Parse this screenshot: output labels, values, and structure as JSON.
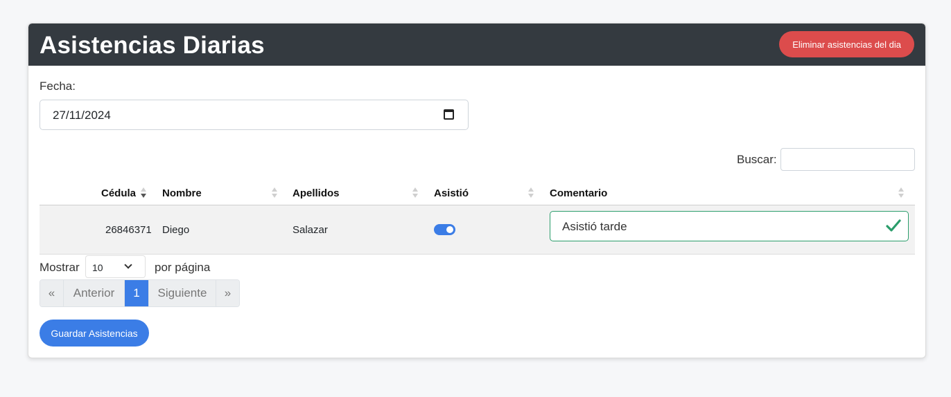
{
  "header": {
    "title": "Asistencias Diarias",
    "delete_button": "Eliminar asistencias del dia"
  },
  "date_field": {
    "label": "Fecha:",
    "value": "27/11/2024",
    "icon": "calendar-icon"
  },
  "search": {
    "label": "Buscar:",
    "value": ""
  },
  "table": {
    "columns": [
      "Cédula",
      "Nombre",
      "Apellidos",
      "Asistió",
      "Comentario"
    ],
    "sorted_column": "Cédula",
    "sort_direction": "desc",
    "rows": [
      {
        "cedula": "26846371",
        "nombre": "Diego",
        "apellidos": "Salazar",
        "asistio": true,
        "comentario": "Asistió tarde"
      }
    ]
  },
  "length_menu": {
    "before": "Mostrar",
    "value": "10",
    "after": "por página"
  },
  "pagination": {
    "first": "«",
    "previous": "Anterior",
    "current": "1",
    "next": "Siguiente",
    "last": "»"
  },
  "save_button": "Guardar Asistencias",
  "colors": {
    "header_bg": "#343a40",
    "danger": "#dc4c4c",
    "primary": "#3b7de6",
    "valid": "#2a9d6b"
  }
}
